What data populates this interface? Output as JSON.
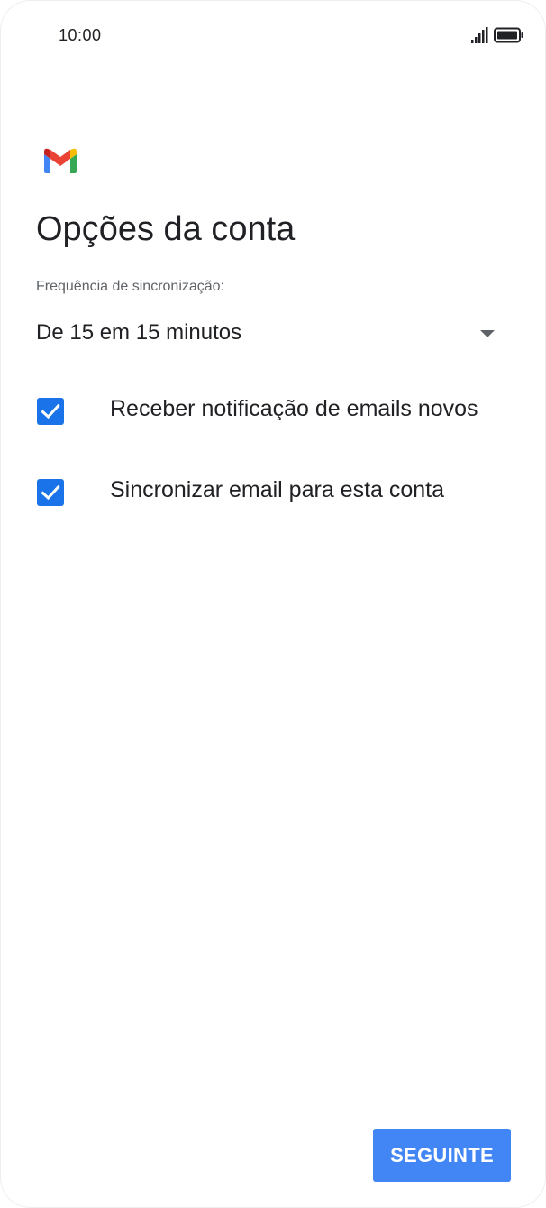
{
  "status_bar": {
    "time": "10:00",
    "signal_icon": "signal-bars-icon",
    "battery_icon": "battery-full-icon"
  },
  "app": {
    "logo_icon": "gmail-logo-icon"
  },
  "page": {
    "title": "Opções da conta"
  },
  "sync": {
    "label": "Frequência de sincronização:",
    "selected": "De 15 em 15 minutos",
    "dropdown_icon": "dropdown-arrow-icon"
  },
  "options": [
    {
      "label": "Receber notificação de emails novos",
      "checked": true
    },
    {
      "label": "Sincronizar email para esta conta",
      "checked": true
    }
  ],
  "actions": {
    "next_label": "SEGUINTE"
  },
  "colors": {
    "accent": "#1a73e8",
    "button": "#4285f4",
    "text": "#202124",
    "secondary_text": "#5f6368"
  }
}
